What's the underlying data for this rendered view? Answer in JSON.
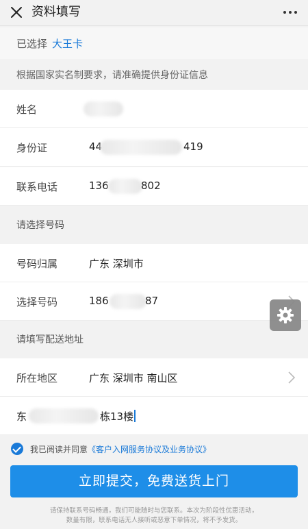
{
  "header": {
    "title": "资料填写",
    "close_icon": "close-icon",
    "more_icon": "more-dots-icon"
  },
  "selected": {
    "label": "已选择",
    "value": "大王卡"
  },
  "notice": "根据国家实名制要求，请准确提供身份证信息",
  "identity": {
    "name": {
      "label": "姓名",
      "value": ""
    },
    "id_card": {
      "label": "身份证",
      "prefix": "44",
      "suffix": "419"
    },
    "phone": {
      "label": "联系电话",
      "prefix": "136",
      "suffix": "802"
    }
  },
  "number_section": {
    "title": "请选择号码",
    "region": {
      "label": "号码归属",
      "value": "广东 深圳市"
    },
    "choose": {
      "label": "选择号码",
      "prefix": "186",
      "suffix": "87"
    }
  },
  "address_section": {
    "title": "请填写配送地址",
    "area": {
      "label": "所在地区",
      "value": "广东 深圳市 南山区"
    },
    "detail": {
      "prefix": "东",
      "suffix": "栋13楼"
    }
  },
  "agreement": {
    "text": "我已阅读并同意",
    "link": "《客户入网服务协议及业务协议》"
  },
  "submit_label": "立即提交，免费送货上门",
  "footnote": [
    "请保持联系号码畅通，我们可能随时与您联系。本次为阶段性优惠活动，",
    "数量有限，联系电话无人接听或恶意下单情况，将不予发货。"
  ],
  "floating": {
    "icon": "gear-icon"
  },
  "colors": {
    "accent": "#1a7ad8",
    "button": "#1e8ee8",
    "background": "#f2f2f2"
  }
}
